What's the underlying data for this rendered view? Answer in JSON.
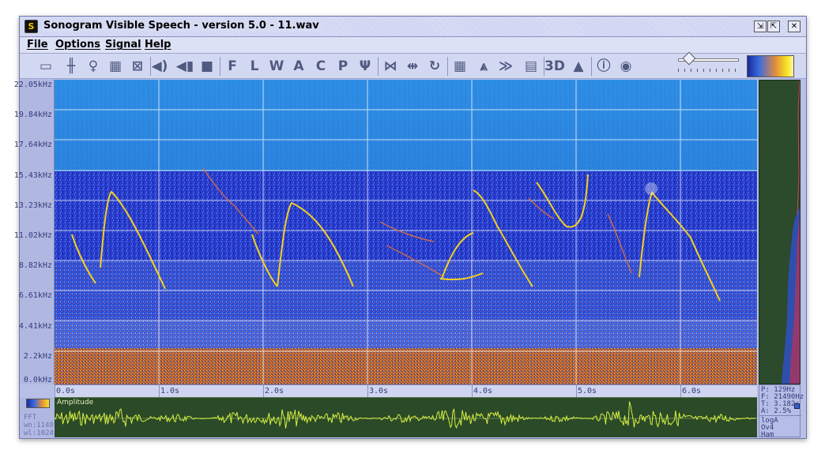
{
  "window": {
    "title": "Sonogram Visible Speech - version 5.0 - 11.wav"
  },
  "menu": {
    "items": [
      "File",
      "Options",
      "Signal",
      "Help"
    ]
  },
  "toolbar": {
    "buttons": [
      {
        "name": "open-file-icon",
        "glyph": "▭"
      },
      {
        "name": "filter-icon",
        "glyph": "╫"
      },
      {
        "name": "microphone-icon",
        "glyph": "♀"
      },
      {
        "name": "layout-icon",
        "glyph": "▦"
      },
      {
        "name": "zoom-fit-icon",
        "glyph": "⊠"
      },
      {
        "name": "speaker-icon",
        "glyph": "◀)"
      },
      {
        "name": "rewind-icon",
        "glyph": "◀▮"
      },
      {
        "name": "stop-icon",
        "glyph": "■"
      },
      {
        "name": "f-icon",
        "glyph": "F"
      },
      {
        "name": "l-icon",
        "glyph": "L"
      },
      {
        "name": "w-icon",
        "glyph": "W"
      },
      {
        "name": "a-icon",
        "glyph": "A"
      },
      {
        "name": "c-icon",
        "glyph": "C"
      },
      {
        "name": "p-icon",
        "glyph": "P"
      },
      {
        "name": "psi-icon",
        "glyph": "Ψ"
      },
      {
        "name": "selection-icon",
        "glyph": "⋈"
      },
      {
        "name": "fit-selection-icon",
        "glyph": "⇹"
      },
      {
        "name": "redo-icon",
        "glyph": "↻"
      },
      {
        "name": "table-icon",
        "glyph": "▦"
      },
      {
        "name": "spectrum-icon",
        "glyph": "⩓"
      },
      {
        "name": "plot-icon",
        "glyph": "≫"
      },
      {
        "name": "book-icon",
        "glyph": "▤"
      },
      {
        "name": "3d-icon",
        "glyph": "3D"
      },
      {
        "name": "mountains-icon",
        "glyph": "▲"
      },
      {
        "name": "info-icon",
        "glyph": "ⓘ"
      },
      {
        "name": "about-icon",
        "glyph": "◉"
      }
    ]
  },
  "yaxis": {
    "labels": [
      "22.05kHz",
      "19.84kHz",
      "17.64kHz",
      "15.43kHz",
      "13.23kHz",
      "11.02kHz",
      "8.82kHz",
      "6.61kHz",
      "4.41kHz",
      "2.2kHz",
      "0.0kHz"
    ]
  },
  "xaxis": {
    "labels": [
      "0.0s",
      "1.0s",
      "2.0s",
      "3.0s",
      "4.0s",
      "5.0s",
      "6.0s"
    ]
  },
  "waveform": {
    "label": "Amplitude"
  },
  "left_info": {
    "fft": "FFT",
    "wn": "wn:1148",
    "wl": "wl:1024"
  },
  "info_panel": {
    "p": "P: 129Hz",
    "f": "F: 21490Hz",
    "t": "T: 3.182s",
    "a": "A: 2.5%",
    "scale": "logA",
    "overlap": "Ov4",
    "window_fn": "Ham"
  },
  "colors": {
    "spectrogram_bg": "#2a3ccc",
    "upper_band": "#2e9ae8",
    "call_trace": "#f4d020",
    "waveform": "#d8f040",
    "panel_green": "#2a4a28"
  }
}
